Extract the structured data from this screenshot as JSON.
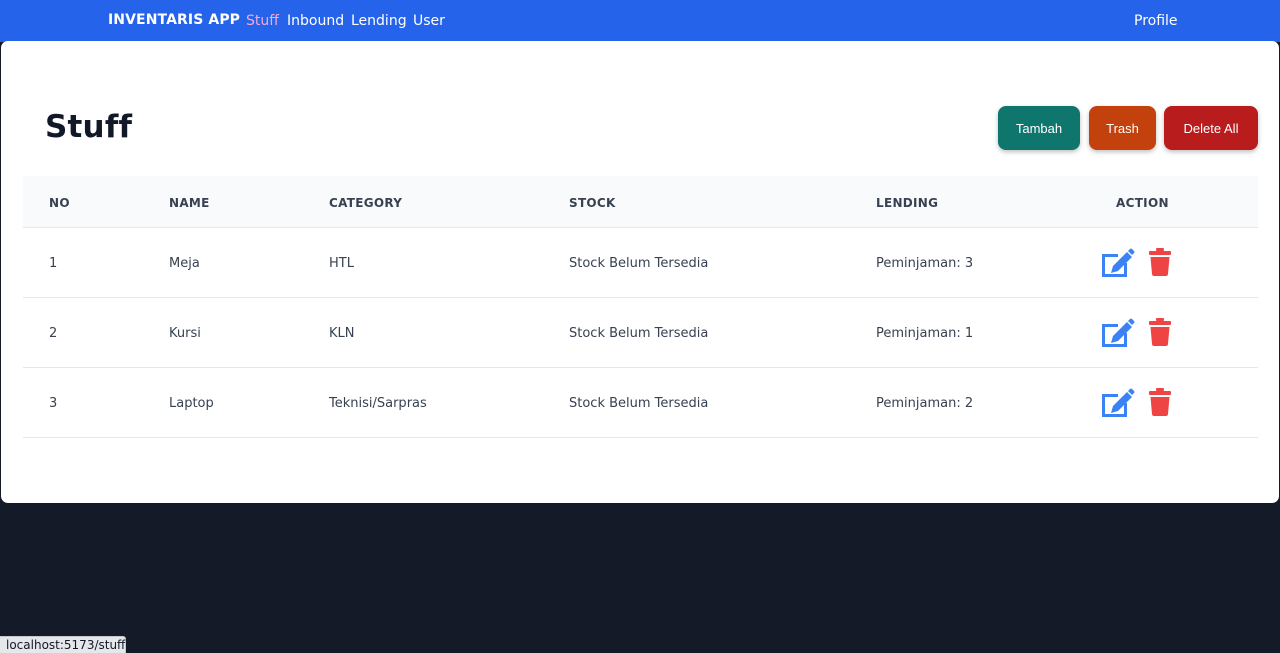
{
  "navbar": {
    "brand": "INVENTARIS APP",
    "links": [
      {
        "label": "Stuff",
        "active": true
      },
      {
        "label": "Inbound",
        "active": false
      },
      {
        "label": "Lending",
        "active": false
      },
      {
        "label": "User",
        "active": false
      }
    ],
    "profile": "Profile",
    "background": "#2563eb",
    "active_color": "#f9a8d4"
  },
  "page": {
    "title": "Stuff",
    "buttons": {
      "tambah": "Tambah",
      "trash": "Trash",
      "delete_all": "Delete All"
    }
  },
  "table": {
    "headers": [
      "NO",
      "NAME",
      "CATEGORY",
      "STOCK",
      "LENDING",
      "ACTION"
    ],
    "rows": [
      {
        "no": "1",
        "name": "Meja",
        "category": "HTL",
        "stock": "Stock Belum Tersedia",
        "lending": "Peminjaman: 3"
      },
      {
        "no": "2",
        "name": "Kursi",
        "category": "KLN",
        "stock": "Stock Belum Tersedia",
        "lending": "Peminjaman: 1"
      },
      {
        "no": "3",
        "name": "Laptop",
        "category": "Teknisi/Sarpras",
        "stock": "Stock Belum Tersedia",
        "lending": "Peminjaman: 2"
      }
    ],
    "action_icons": [
      "edit-icon",
      "trash-icon"
    ],
    "colors": {
      "edit": "#3b82f6",
      "delete": "#ef4444"
    }
  },
  "statusbar": {
    "url": "localhost:5173/stuff"
  }
}
